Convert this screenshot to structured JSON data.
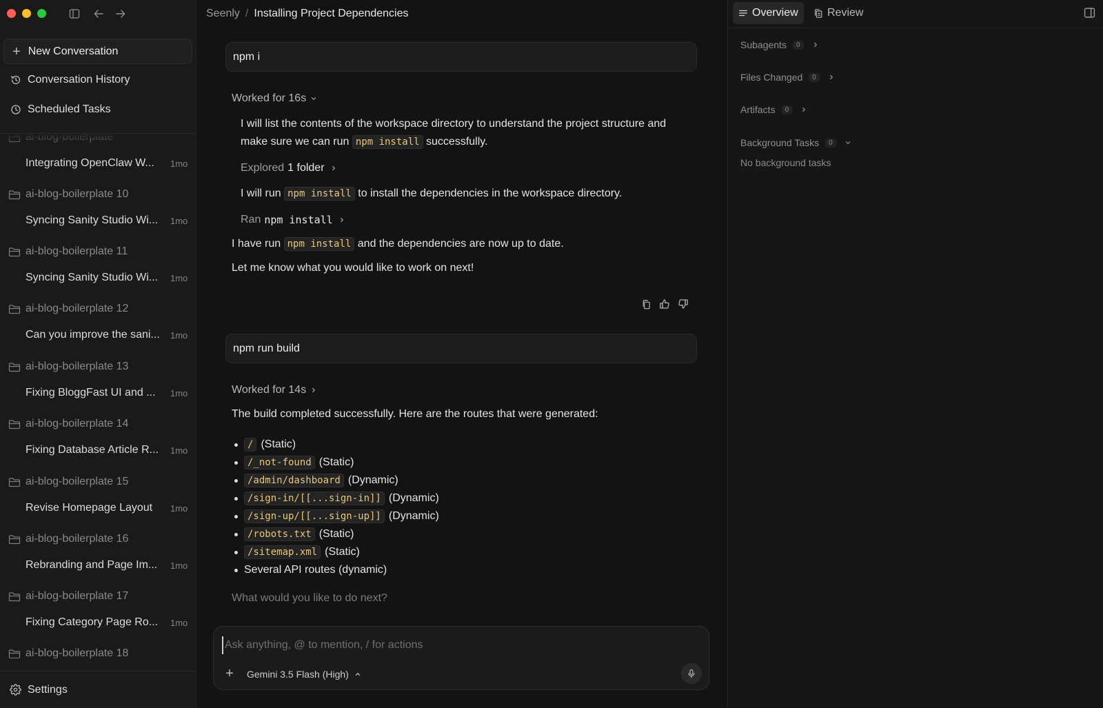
{
  "window": {
    "traffic_colors": [
      "#fe5f57",
      "#febc2e",
      "#28c840"
    ]
  },
  "sidebar": {
    "new_conversation": "New Conversation",
    "conversation_history": "Conversation History",
    "scheduled_tasks": "Scheduled Tasks",
    "settings": "Settings",
    "projects": [
      {
        "folder": "ai-blog-boilerplate",
        "title": "Integrating OpenClaw W...",
        "age": "1mo"
      },
      {
        "folder": "ai-blog-boilerplate 10",
        "title": "Syncing Sanity Studio Wi...",
        "age": "1mo"
      },
      {
        "folder": "ai-blog-boilerplate 11",
        "title": "Syncing Sanity Studio Wi...",
        "age": "1mo"
      },
      {
        "folder": "ai-blog-boilerplate 12",
        "title": "Can you improve the sani...",
        "age": "1mo"
      },
      {
        "folder": "ai-blog-boilerplate 13",
        "title": "Fixing BloggFast UI and ...",
        "age": "1mo"
      },
      {
        "folder": "ai-blog-boilerplate 14",
        "title": "Fixing Database Article R...",
        "age": "1mo"
      },
      {
        "folder": "ai-blog-boilerplate 15",
        "title": "Revise Homepage Layout",
        "age": "1mo"
      },
      {
        "folder": "ai-blog-boilerplate 16",
        "title": "Rebranding and Page Im...",
        "age": "1mo"
      },
      {
        "folder": "ai-blog-boilerplate 17",
        "title": "Fixing Category Page Ro...",
        "age": "1mo"
      },
      {
        "folder": "ai-blog-boilerplate 18",
        "title": "",
        "age": ""
      }
    ]
  },
  "breadcrumb": {
    "workspace": "Seenly",
    "separator": "/",
    "conversation": "Installing Project Dependencies"
  },
  "chat": {
    "msg1": {
      "user": "npm i",
      "worked": "Worked for 16s",
      "p1_before": "I will list the contents of the workspace directory to understand the project structure and make sure we can run ",
      "p1_code": "npm install",
      "p1_after": " successfully.",
      "explored_prefix": "Explored",
      "explored_value": "1 folder",
      "p2_before": "I will run ",
      "p2_code": "npm install",
      "p2_after": " to install the dependencies in the workspace directory.",
      "ran_prefix": "Ran",
      "ran_value": "npm install",
      "p3_before": "I have run ",
      "p3_code": "npm install",
      "p3_after": " and the dependencies are now up to date.",
      "p4": "Let me know what you would like to work on next!"
    },
    "msg2": {
      "user": "npm run build",
      "worked": "Worked for 14s",
      "intro": "The build completed successfully. Here are the routes that were generated:",
      "routes": [
        {
          "path": "/",
          "kind": "(Static)"
        },
        {
          "path": "/_not-found",
          "kind": "(Static)"
        },
        {
          "path": "/admin/dashboard",
          "kind": "(Dynamic)"
        },
        {
          "path": "/sign-in/[[...sign-in]]",
          "kind": "(Dynamic)"
        },
        {
          "path": "/sign-up/[[...sign-up]]",
          "kind": "(Dynamic)"
        },
        {
          "path": "/robots.txt",
          "kind": "(Static)"
        },
        {
          "path": "/sitemap.xml",
          "kind": "(Static)"
        },
        {
          "path": "",
          "kind": "Several API routes (dynamic)"
        }
      ],
      "next": "What would you like to do next?"
    }
  },
  "composer": {
    "placeholder": "Ask anything, @ to mention, / for actions",
    "value": "",
    "model": "Gemini 3.5 Flash (High)"
  },
  "right_panel": {
    "tabs": [
      "Overview",
      "Review"
    ],
    "sections": [
      {
        "label": "Subagents",
        "count": "0"
      },
      {
        "label": "Files Changed",
        "count": "0"
      },
      {
        "label": "Artifacts",
        "count": "0"
      },
      {
        "label": "Background Tasks",
        "count": "0"
      }
    ],
    "background_empty": "No background tasks"
  },
  "colors": {
    "code_text": "#e8c77b",
    "background": "#131313",
    "sidebar": "#1a1a1a"
  }
}
